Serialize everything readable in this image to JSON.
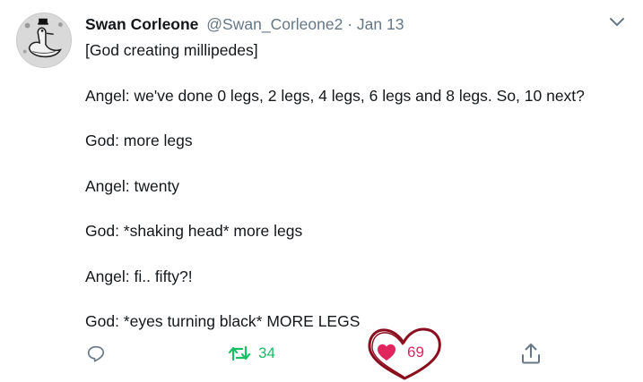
{
  "tweet": {
    "display_name": "Swan Corleone",
    "handle": "@Swan_Corleone2",
    "separator": "·",
    "date": "Jan 13",
    "lines": [
      "[God creating millipedes]",
      "Angel: we've done 0 legs, 2 legs, 4 legs, 6 legs and 8 legs. So, 10 next?",
      "God: more legs",
      "Angel: twenty",
      "God: *shaking head* more legs",
      "Angel: fi.. fifty?!",
      "God: *eyes turning black* MORE LEGS"
    ]
  },
  "actions": {
    "reply": {
      "icon": "reply-icon"
    },
    "retweet": {
      "icon": "retweet-icon",
      "count": "34",
      "color": "#17bf63"
    },
    "like": {
      "icon": "heart-icon",
      "count": "69",
      "color": "#e0245e"
    },
    "share": {
      "icon": "share-icon"
    }
  },
  "colors": {
    "muted": "#657786",
    "text": "#14171a",
    "annotation": "#8b0d1e"
  }
}
